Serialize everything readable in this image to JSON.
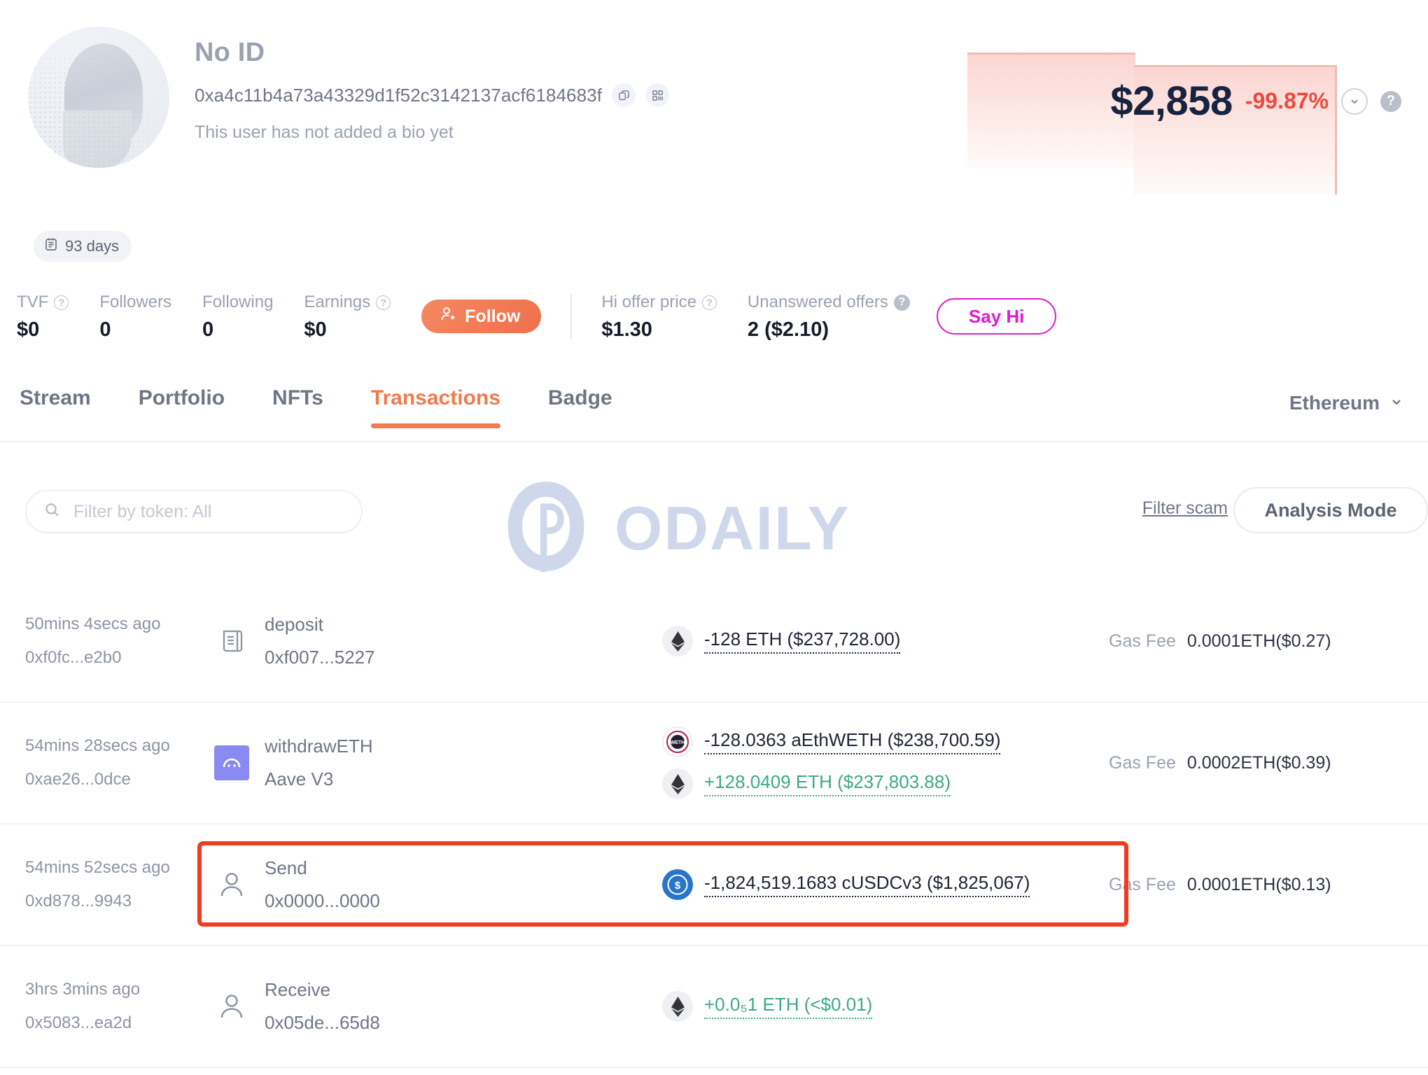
{
  "profile": {
    "name": "No ID",
    "address": "0xa4c11b4a73a43329d1f52c3142137acf6184683f",
    "bio": "This user has not added a bio yet",
    "days_badge": "93 days",
    "copy_icon": "copy-icon",
    "qr_icon": "qr-code-icon",
    "calendar_icon": "calendar-icon"
  },
  "price_card": {
    "value": "$2,858",
    "change": "-99.87%",
    "change_color": "#ea4a3c",
    "chevron_icon": "chevron-down-icon",
    "help_icon": "question-mark-icon"
  },
  "stats": [
    {
      "label": "TVF",
      "value": "$0",
      "help": "?"
    },
    {
      "label": "Followers",
      "value": "0",
      "help": ""
    },
    {
      "label": "Following",
      "value": "0",
      "help": ""
    },
    {
      "label": "Earnings",
      "value": "$0",
      "help": "?"
    }
  ],
  "follow_button": {
    "label": "Follow",
    "icon": "user-plus-icon"
  },
  "offer_stats": [
    {
      "label": "Hi offer price",
      "value": "$1.30",
      "help": "?"
    },
    {
      "label": "Unanswered offers",
      "value": "2 ($2.10)",
      "help": "?"
    }
  ],
  "say_hi_button": {
    "label": "Say Hi",
    "color": "#e21ad0"
  },
  "tabs": [
    {
      "label": "Stream",
      "active": false
    },
    {
      "label": "Portfolio",
      "active": false
    },
    {
      "label": "NFTs",
      "active": false
    },
    {
      "label": "Transactions",
      "active": true
    },
    {
      "label": "Badge",
      "active": false
    }
  ],
  "chain_selector": {
    "label": "Ethereum",
    "icon": "chevron-down-icon"
  },
  "filters": {
    "search_placeholder": "Filter by token: All",
    "search_icon": "search-icon",
    "filter_scam": "Filter scam",
    "analysis_mode": "Analysis Mode"
  },
  "watermark": {
    "text": "ODAILY",
    "logo": "odaily-logo-icon"
  },
  "transactions": [
    {
      "time": "50mins 4secs ago",
      "hash": "0xf0fc...e2b0",
      "action": "deposit",
      "action_sub": "0xf007...5227",
      "action_icon": "contract-receipt-icon",
      "amounts": [
        {
          "text": "-128 ETH ($237,728.00)",
          "sign": "neg",
          "token_icon": "eth-icon"
        }
      ],
      "gas_label": "Gas Fee",
      "gas_value": "0.0001ETH($0.27)",
      "highlighted": false
    },
    {
      "time": "54mins 28secs ago",
      "hash": "0xae26...0dce",
      "action": "withdrawETH",
      "action_sub": "Aave V3",
      "action_icon": "aave-icon",
      "amounts": [
        {
          "text": "-128.0363 aEthWETH ($238,700.59)",
          "sign": "neg",
          "token_icon": "weth-icon"
        },
        {
          "text": "+128.0409 ETH ($237,803.88)",
          "sign": "pos",
          "token_icon": "eth-icon"
        }
      ],
      "gas_label": "Gas Fee",
      "gas_value": "0.0002ETH($0.39)",
      "highlighted": false
    },
    {
      "time": "54mins 52secs ago",
      "hash": "0xd878...9943",
      "action": "Send",
      "action_sub": "0x0000...0000",
      "action_icon": "user-icon",
      "amounts": [
        {
          "text": "-1,824,519.1683 cUSDCv3 ($1,825,067)",
          "sign": "neg",
          "token_icon": "usdc-icon"
        }
      ],
      "gas_label": "Gas Fee",
      "gas_value": "0.0001ETH($0.13)",
      "highlighted": true,
      "highlight_color": "#ef3b1f"
    },
    {
      "time": "3hrs 3mins ago",
      "hash": "0x5083...ea2d",
      "action": "Receive",
      "action_sub": "0x05de...65d8",
      "action_icon": "user-icon",
      "amounts": [
        {
          "text": "+0.0₅1 ETH (<$0.01)",
          "sign": "pos",
          "token_icon": "eth-icon"
        }
      ],
      "gas_label": "",
      "gas_value": "",
      "highlighted": false
    }
  ]
}
